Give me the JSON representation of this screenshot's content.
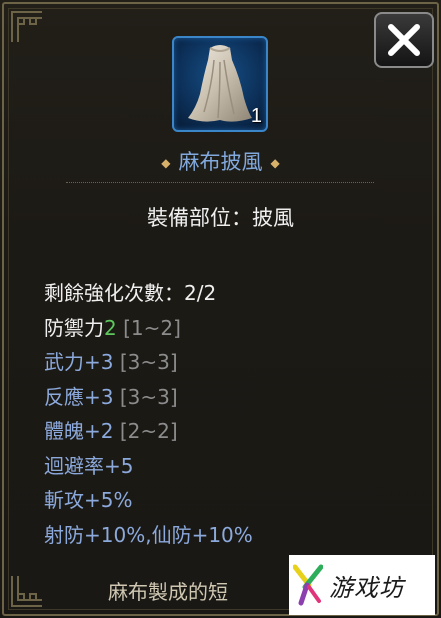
{
  "item": {
    "name": "麻布披風",
    "count": "1",
    "icon": "cloak-icon",
    "equip_slot": "裝備部位：披風"
  },
  "close_button": {
    "icon": "close-icon"
  },
  "stats": {
    "enhance": "剩餘強化次數：2/2",
    "defense_label": "防禦力",
    "defense_value": "2",
    "defense_range": "[1~2]",
    "martial": "武力+3",
    "martial_range": "[3~3]",
    "reaction": "反應+3",
    "reaction_range": "[3~3]",
    "physique": "體魄+2",
    "physique_range": "[2~2]",
    "evasion": "迴避率+5",
    "slash_attack": "斬攻+5%",
    "resistances": "射防+10%,仙防+10%"
  },
  "description": "麻布製成的短",
  "watermark": {
    "text": "游戏坊",
    "icon": "youxifang-logo-icon"
  },
  "colors": {
    "item_name": "#82a9de",
    "defense_value": "#5dc85d",
    "bonus_stat": "#8ca9dc",
    "range": "#8c8c8c",
    "icon_border": "#3b86c8"
  }
}
